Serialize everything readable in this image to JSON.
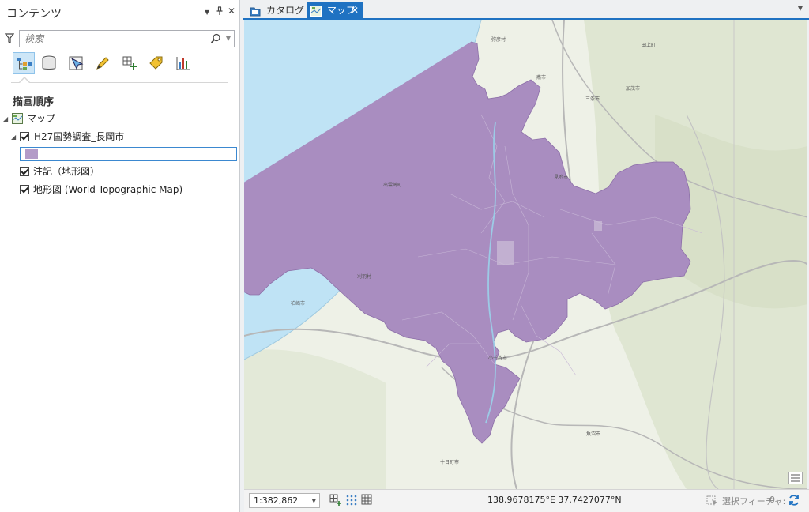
{
  "contents_pane": {
    "title": "コンテンツ",
    "pin_label": "ㅂ",
    "close_label": "✕",
    "menu_label": "▼",
    "search": {
      "placeholder": "検索",
      "value": ""
    },
    "toolbar": [
      {
        "icon": "list-by-drawing-order-icon",
        "active": true
      },
      {
        "icon": "list-by-data-source-icon",
        "active": false
      },
      {
        "icon": "list-by-selection-icon",
        "active": false
      },
      {
        "icon": "list-by-editing-icon",
        "active": false
      },
      {
        "icon": "list-by-snapping-icon",
        "active": false
      },
      {
        "icon": "list-by-labeling-icon",
        "active": false
      },
      {
        "icon": "list-charts-icon",
        "active": false
      }
    ],
    "section_title": "描画順序",
    "tree": {
      "map_name": "マップ",
      "layer1": "H27国勢調査_長岡市",
      "layer1_symbol_color": "#b39bc8",
      "layer2": "注記（地形図）",
      "layer3": "地形図 (World Topographic Map)"
    }
  },
  "tabs": {
    "catalog": "カタログ",
    "map": "マップ",
    "close": "✕"
  },
  "map": {
    "labels": {
      "yahiko": "弥彦村",
      "izumozaki": "出雲崎町",
      "kariwa": "刈羽村",
      "kashiwazaki": "柏崎市",
      "ojiya": "小千谷市",
      "mitsuke": "見附市",
      "sanjo": "三条市",
      "kamo": "加茂市",
      "tagami": "田上町",
      "tsubame": "燕市",
      "uonuma": "魚沼市",
      "tokamachi": "十日町市"
    },
    "colors": {
      "sea": "#bfe3f5",
      "land": "#eef1e7",
      "hills": "#dfe6d2",
      "polygon": "#a98dc0",
      "road": "#b7b7b7"
    }
  },
  "statusbar": {
    "scale": "1:382,862",
    "coordinates": "138.9678175°E 37.7427077°N",
    "selected_features_label": "選択フィーチャ:",
    "selected_features_count": "0"
  }
}
